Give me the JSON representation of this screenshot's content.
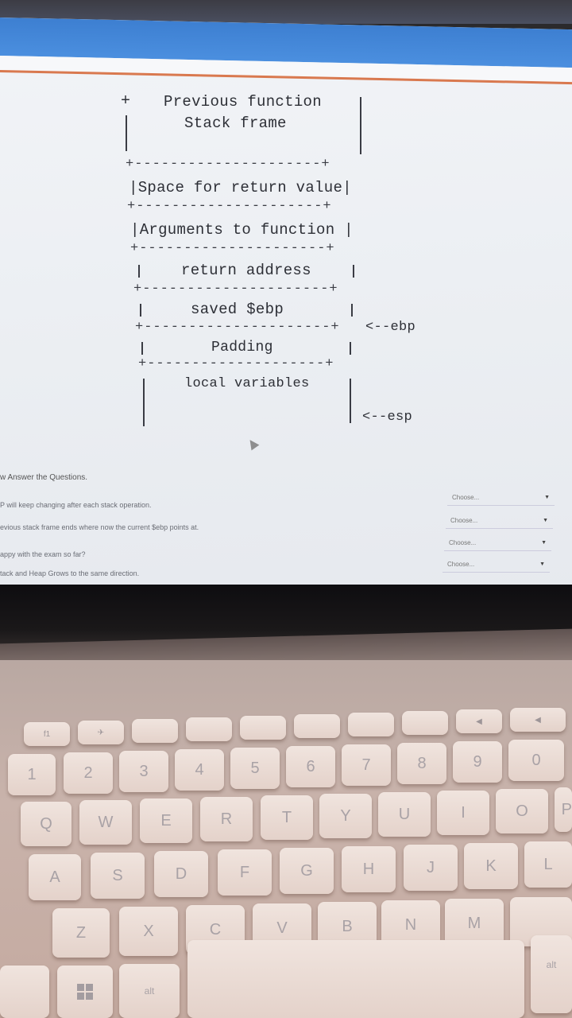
{
  "diagram": {
    "prev_line1": "Previous function",
    "prev_line2": "Stack frame",
    "return_value": "Space for return value",
    "arguments": "Arguments to function",
    "return_address": "return address",
    "saved_ebp": "saved $ebp",
    "padding": "Padding",
    "local_vars": "local variables",
    "ebp_pointer": "<--ebp",
    "esp_pointer": "<--esp"
  },
  "questions": {
    "title": "w Answer the Questions.",
    "items": [
      "P will keep changing after each stack operation.",
      "evious stack frame ends where now the current $ebp points at.",
      "appy with the exam so far?",
      "tack and Heap Grows to the same direction."
    ],
    "select_placeholder": "Choose..."
  },
  "keyboard": {
    "number_row": [
      "1",
      "2",
      "3",
      "4",
      "5",
      "6",
      "7",
      "8",
      "9",
      "0"
    ],
    "top_row": [
      "Q",
      "W",
      "E",
      "R",
      "T",
      "Y",
      "U",
      "I",
      "O",
      "P"
    ],
    "home_row": [
      "A",
      "S",
      "D",
      "F",
      "G",
      "H",
      "J",
      "K",
      "L"
    ],
    "bottom_row": [
      "Z",
      "X",
      "C",
      "V",
      "B",
      "N",
      "M"
    ],
    "alt_left": "alt",
    "alt_right": "alt"
  }
}
